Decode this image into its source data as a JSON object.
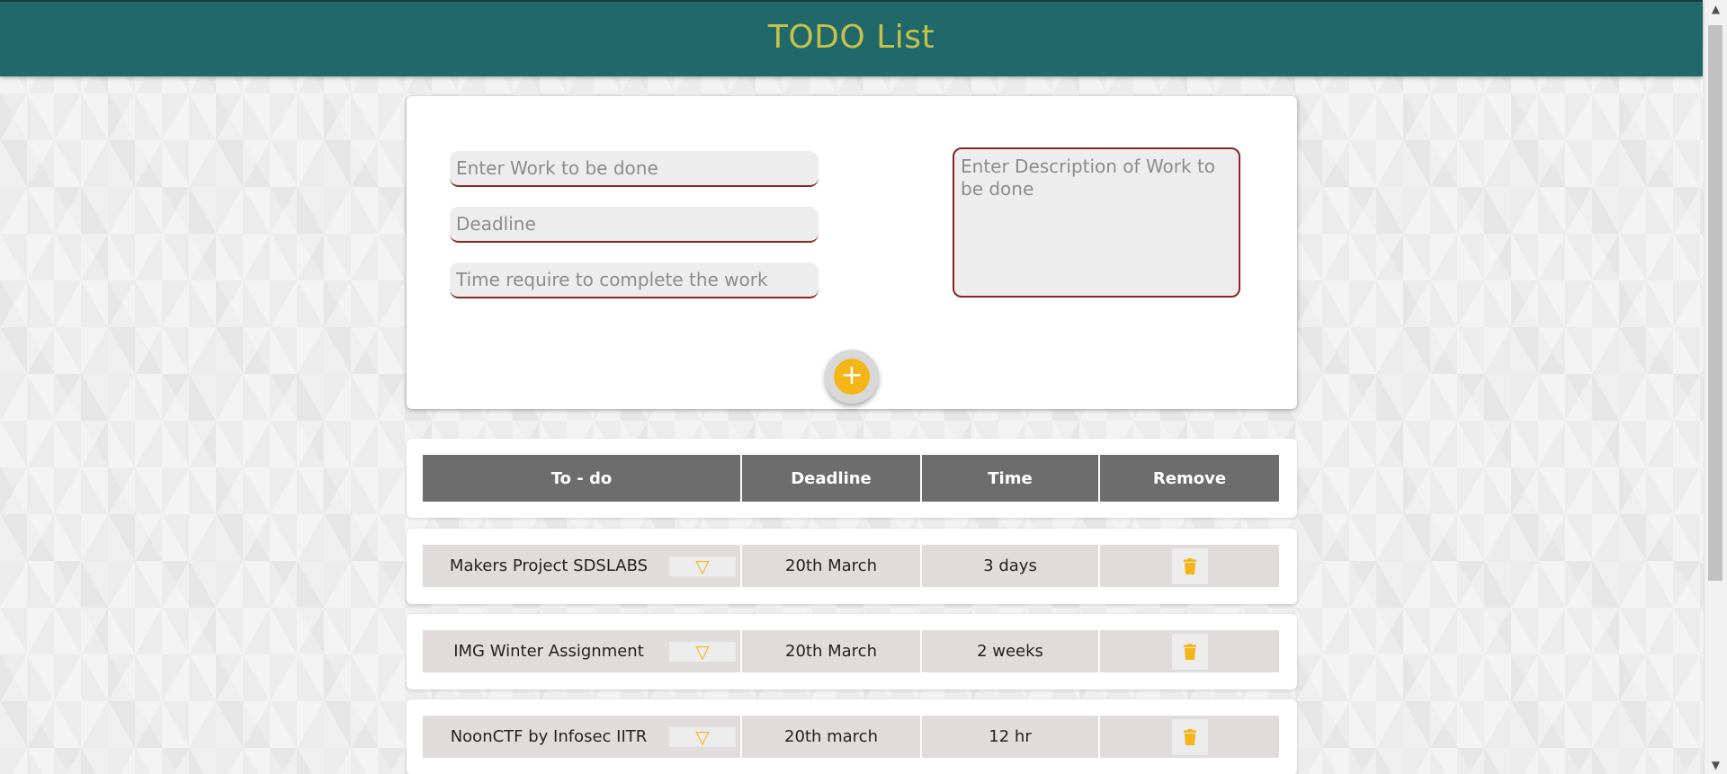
{
  "header": {
    "title": "TODO List"
  },
  "form": {
    "work_placeholder": "Enter Work to be done",
    "deadline_placeholder": "Deadline",
    "time_placeholder": "Time require to complete the work",
    "description_placeholder": "Enter Description of Work to be done",
    "add_label": "+"
  },
  "table": {
    "columns": [
      "To - do",
      "Deadline",
      "Time",
      "Remove"
    ],
    "rows": [
      {
        "task": "Makers Project SDSLABS",
        "deadline": "20th March",
        "time": "3 days"
      },
      {
        "task": "IMG Winter Assignment",
        "deadline": "20th March",
        "time": "2 weeks"
      },
      {
        "task": "NoonCTF by Infosec IITR",
        "deadline": "20th march",
        "time": "12 hr"
      }
    ],
    "expand_icon": "▽",
    "remove_icon": "trash-icon"
  },
  "colors": {
    "header_bg": "#20686a",
    "title": "#c6c14a",
    "accent": "#f4b516",
    "field_border": "#8a2622",
    "table_head_bg": "#6d6d6d",
    "row_bg": "#e1dcdc"
  }
}
